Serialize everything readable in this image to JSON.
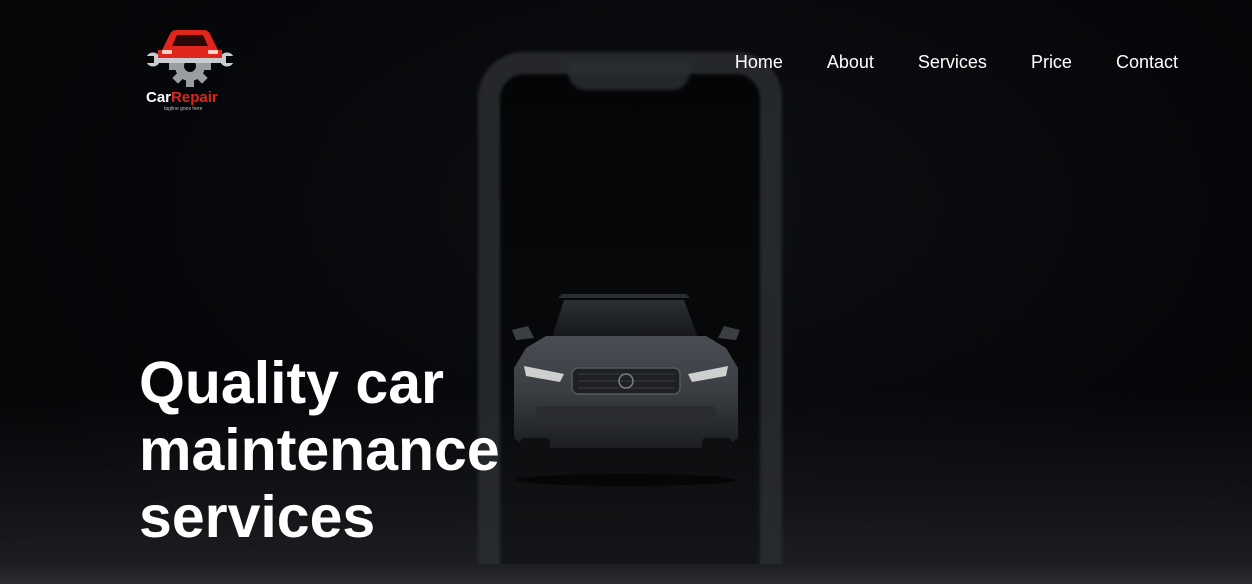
{
  "brand": {
    "name_part1": "Car",
    "name_part2": "Repair",
    "tagline": "tagline goes here",
    "colors": {
      "accent_red": "#e0261c",
      "gear_gray": "#9a9ea3"
    },
    "logo_icon": "car-gear-wrench-logo"
  },
  "nav": {
    "items": [
      {
        "label": "Home"
      },
      {
        "label": "About"
      },
      {
        "label": "Services"
      },
      {
        "label": "Price"
      },
      {
        "label": "Contact"
      }
    ]
  },
  "hero": {
    "line1": "Quality car",
    "line2": "maintenance",
    "line3": "services",
    "background_image": "dark-car-inside-phone-frame"
  }
}
